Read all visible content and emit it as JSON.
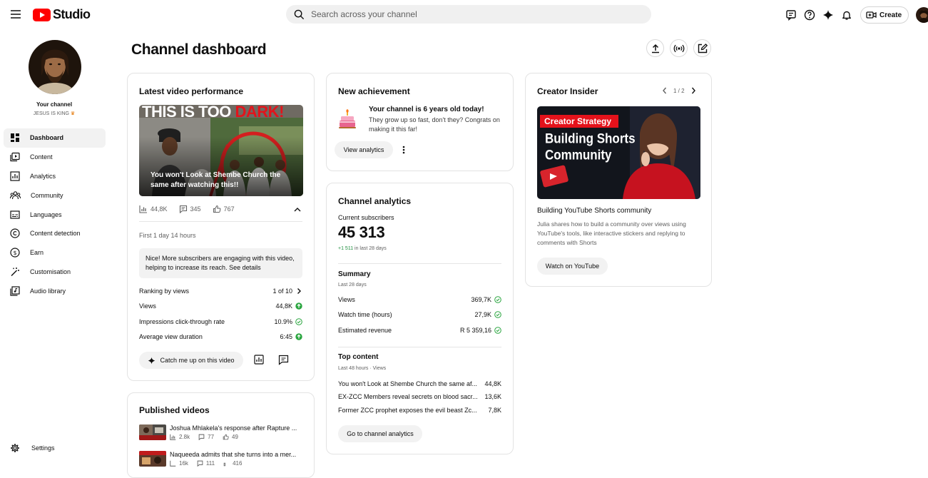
{
  "app": {
    "logo_text": "Studio"
  },
  "search": {
    "placeholder": "Search across your channel"
  },
  "topbar": {
    "create_label": "Create"
  },
  "channel": {
    "title": "Your channel",
    "name": "JESUS IS KING"
  },
  "nav": {
    "items": [
      {
        "label": "Dashboard",
        "icon": "dashboard-icon",
        "active": true
      },
      {
        "label": "Content",
        "icon": "content-icon"
      },
      {
        "label": "Analytics",
        "icon": "analytics-icon"
      },
      {
        "label": "Community",
        "icon": "community-icon"
      },
      {
        "label": "Languages",
        "icon": "languages-icon"
      },
      {
        "label": "Content detection",
        "icon": "copyright-icon"
      },
      {
        "label": "Earn",
        "icon": "earn-icon"
      },
      {
        "label": "Customisation",
        "icon": "magic-wand-icon"
      },
      {
        "label": "Audio library",
        "icon": "audio-library-icon"
      }
    ],
    "settings_label": "Settings"
  },
  "page": {
    "title": "Channel dashboard"
  },
  "latest": {
    "title": "Latest video performance",
    "thumb_headline_a": "THIS IS TOO ",
    "thumb_headline_b": "DARK!",
    "thumb_caption": "You won't Look at Shembe Church the same after watching this!!",
    "views": "44,8K",
    "comments": "345",
    "likes": "767",
    "period": "First 1 day 14 hours",
    "insight": "Nice! More subscribers are engaging with this video, helping to increase its reach. See details",
    "rows": [
      {
        "label": "Ranking by views",
        "value": "1 of 10"
      },
      {
        "label": "Views",
        "value": "44,8K"
      },
      {
        "label": "Impressions click-through rate",
        "value": "10.9%"
      },
      {
        "label": "Average view duration",
        "value": "6:45"
      }
    ],
    "catch_me_up": "Catch me up on this video"
  },
  "published": {
    "title": "Published videos",
    "videos": [
      {
        "title": "Joshua Mhlakela's response after Rapture ...",
        "views": "2.8k",
        "comments": "77",
        "likes": "49"
      },
      {
        "title": "Naqueeda admits that she turns into a mer...",
        "views": "16k",
        "comments": "111",
        "likes": "416"
      }
    ]
  },
  "achievement": {
    "title": "New achievement",
    "heading": "Your channel is 6 years old today!",
    "body": "They grow up so fast, don't they? Congrats on making it this far!",
    "button": "View analytics"
  },
  "analytics": {
    "title": "Channel analytics",
    "subs_label": "Current subscribers",
    "subs_value": "45 313",
    "subs_delta": "+1 511",
    "subs_delta_suffix": " in last 28 days",
    "summary_title": "Summary",
    "summary_period": "Last 28 days",
    "summary": [
      {
        "label": "Views",
        "value": "369,7K"
      },
      {
        "label": "Watch time (hours)",
        "value": "27,9K"
      },
      {
        "label": "Estimated revenue",
        "value": "R 5 359,16"
      }
    ],
    "top_title": "Top content",
    "top_period": "Last 48 hours · Views",
    "top": [
      {
        "title": "You won't Look at Shembe Church the same af...",
        "value": "44,8K"
      },
      {
        "title": "EX-ZCC Members reveal secrets on blood sacr...",
        "value": "13,6K"
      },
      {
        "title": "Former ZCC prophet exposes the evil beast Zc...",
        "value": "7,8K"
      }
    ],
    "button": "Go to channel analytics"
  },
  "insider": {
    "title": "Creator Insider",
    "pager": "1 / 2",
    "thumb_tag": "Creator Strategy",
    "thumb_line1": "Building Shorts",
    "thumb_line2": "Community",
    "video_title": "Building YouTube Shorts community",
    "description": "Julia shares how to build a community over views using YouTube's tools, like interactive stickers and replying to comments with Shorts",
    "button": "Watch on YouTube"
  },
  "colors": {
    "brand_red": "#ff0000",
    "positive_green": "#2ba640",
    "subs_delta_green": "#1e8e3e"
  }
}
